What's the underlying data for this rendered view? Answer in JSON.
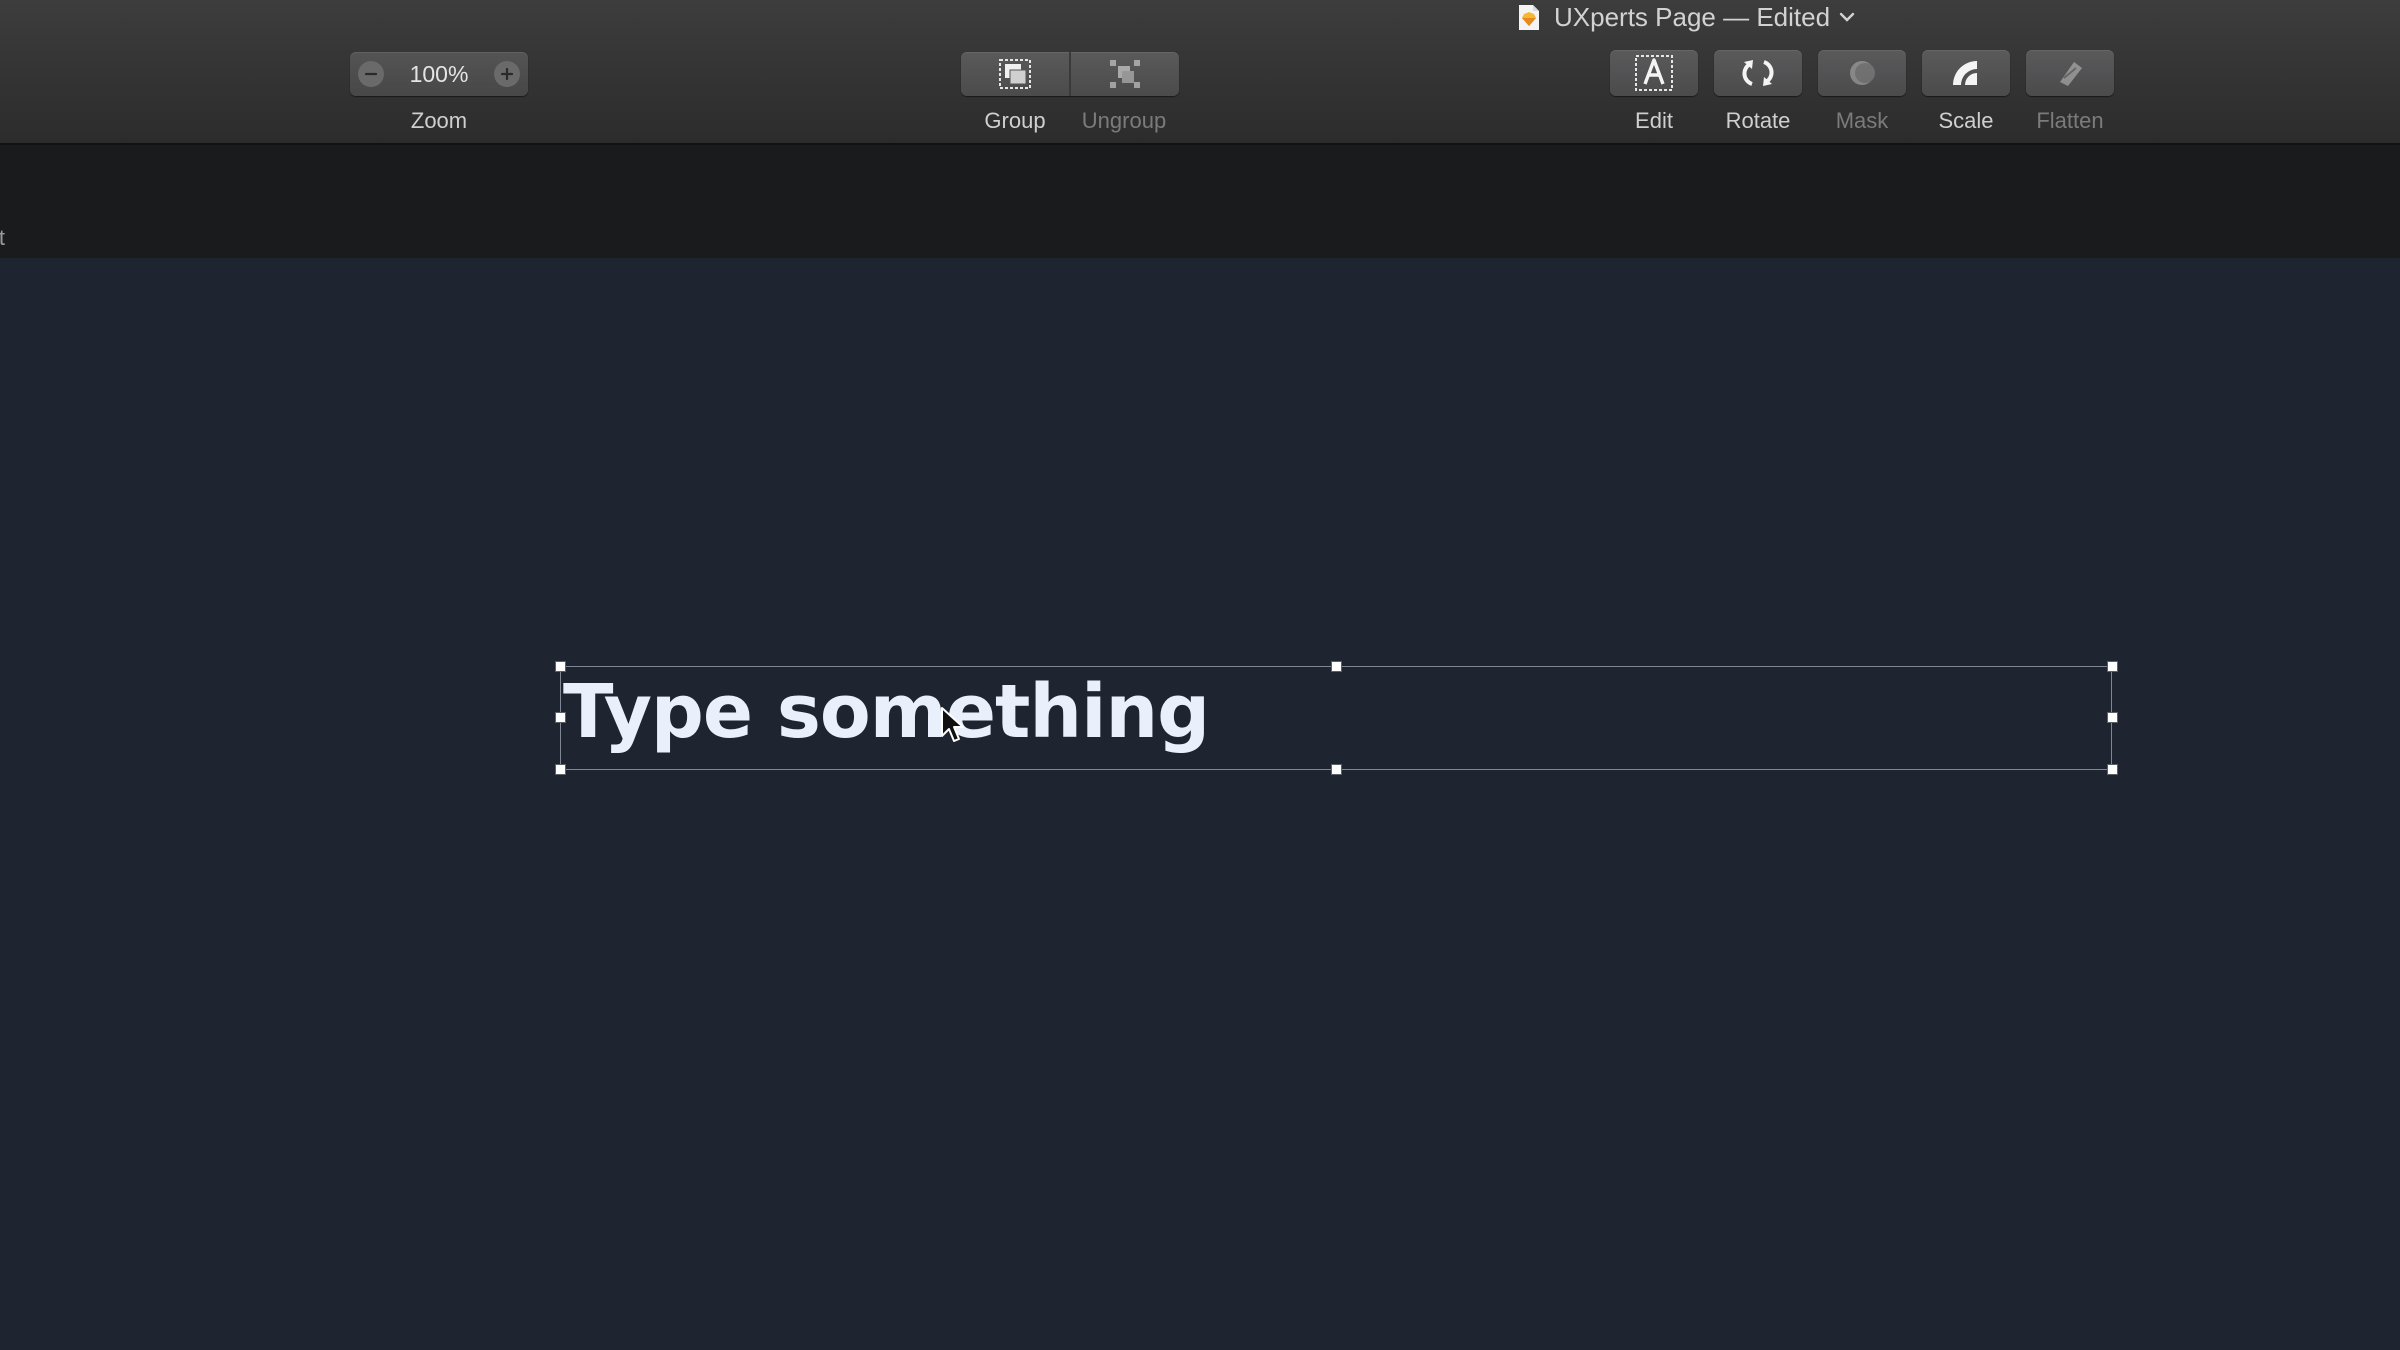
{
  "window": {
    "title": "UXperts Page — Edited"
  },
  "toolbar": {
    "zoom": {
      "value": "100%",
      "label": "Zoom"
    },
    "group": {
      "label": "Group",
      "enabled": true
    },
    "ungroup": {
      "label": "Ungroup",
      "enabled": false
    },
    "edit": {
      "label": "Edit",
      "enabled": true,
      "icon": "text-edit-icon"
    },
    "rotate": {
      "label": "Rotate",
      "enabled": true,
      "icon": "rotate-icon"
    },
    "mask": {
      "label": "Mask",
      "enabled": false,
      "icon": "mask-icon"
    },
    "scale": {
      "label": "Scale",
      "enabled": true,
      "icon": "scale-icon"
    },
    "flatten": {
      "label": "Flatten",
      "enabled": false,
      "icon": "flatten-icon"
    }
  },
  "subbar": {
    "partial_text": "lt"
  },
  "canvas": {
    "background": "#1f2530",
    "text_layer": {
      "content": "Type something",
      "color": "#eaf0fb",
      "selected": true
    }
  }
}
